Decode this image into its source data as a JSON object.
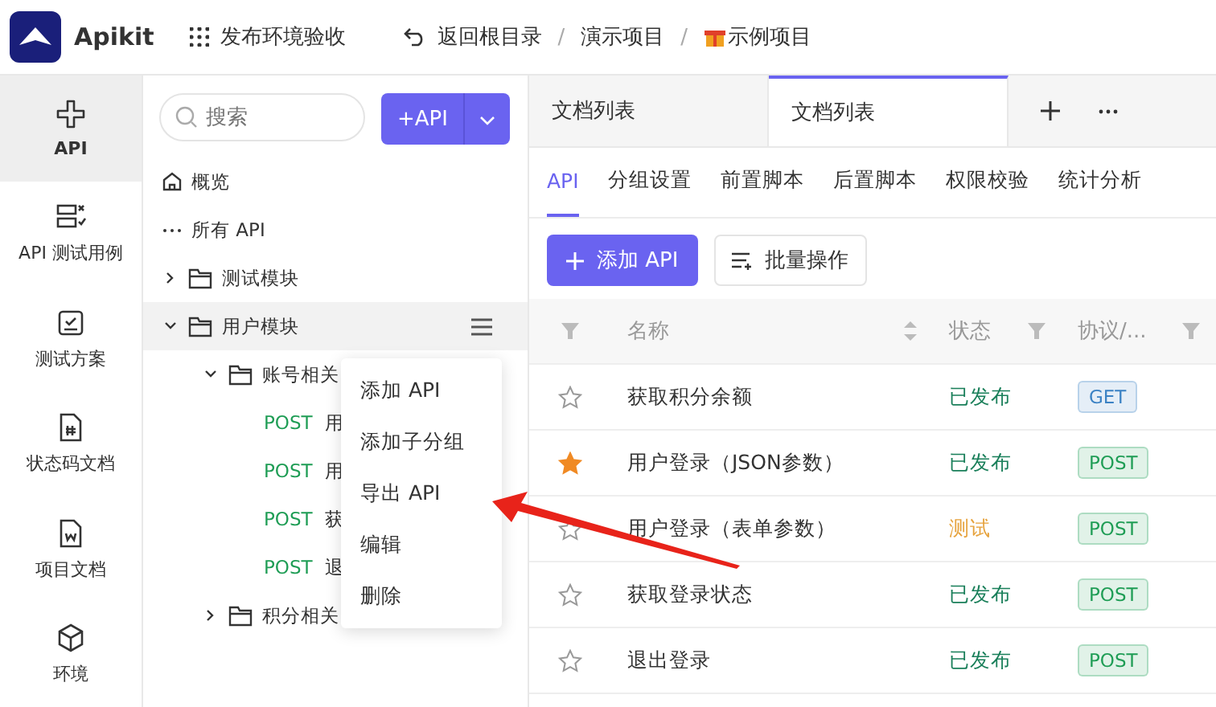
{
  "header": {
    "logo": "Apikit",
    "workspace": "发布环境验收",
    "back": "返回根目录",
    "separator": "/",
    "breadcrumbs": [
      "演示项目",
      "示例项目"
    ]
  },
  "nav": [
    {
      "label": "API",
      "selected": true,
      "kind": "api"
    },
    {
      "label": "API 测试用例",
      "selected": false,
      "kind": "cases"
    },
    {
      "label": "测试方案",
      "selected": false,
      "kind": "plan"
    },
    {
      "label": "状态码文档",
      "selected": false,
      "kind": "code"
    },
    {
      "label": "项目文档",
      "selected": false,
      "kind": "doc"
    },
    {
      "label": "环境",
      "selected": false,
      "kind": "env"
    }
  ],
  "tree": {
    "search": {
      "placeholder": "搜索"
    },
    "add_button": "+API",
    "items": [
      {
        "kind": "overview",
        "label": "概览",
        "selected": false
      },
      {
        "kind": "all",
        "label": "所有 API",
        "selected": false
      },
      {
        "kind": "folder",
        "label": "测试模块",
        "expanded": false,
        "selected": false
      },
      {
        "kind": "folder",
        "label": "用户模块",
        "expanded": true,
        "selected": true,
        "children": [
          {
            "kind": "folder",
            "label": "账号相关",
            "expanded": true,
            "selected": false,
            "children": [
              {
                "kind": "api",
                "method": "POST",
                "label": "用",
                "selected": false
              },
              {
                "kind": "api",
                "method": "POST",
                "label": "用",
                "selected": false
              },
              {
                "kind": "api",
                "method": "POST",
                "label": "获",
                "selected": false
              },
              {
                "kind": "api",
                "method": "POST",
                "label": "退",
                "selected": false
              }
            ]
          },
          {
            "kind": "folder",
            "label": "积分相关",
            "expanded": false,
            "selected": false
          }
        ]
      }
    ]
  },
  "context_menu": [
    "添加 API",
    "添加子分组",
    "导出 API",
    "编辑",
    "删除"
  ],
  "tabs": [
    {
      "label": "文档列表",
      "selected": false
    },
    {
      "label": "文档列表",
      "selected": true
    }
  ],
  "subtabs": [
    {
      "label": "API",
      "selected": true
    },
    {
      "label": "分组设置",
      "selected": false
    },
    {
      "label": "前置脚本",
      "selected": false
    },
    {
      "label": "后置脚本",
      "selected": false
    },
    {
      "label": "权限校验",
      "selected": false
    },
    {
      "label": "统计分析",
      "selected": false
    }
  ],
  "toolbar": {
    "add_button": "添加 API",
    "batch_button": "批量操作"
  },
  "table": {
    "columns": [
      "名称",
      "状态",
      "协议/..."
    ],
    "rows": [
      {
        "starred": false,
        "name": "获取积分余额",
        "status": {
          "text": "已发布",
          "color": "#1a7f5a"
        },
        "method": {
          "text": "GET",
          "color": "#3b82c4"
        }
      },
      {
        "starred": true,
        "name": "用户登录（JSON参数）",
        "status": {
          "text": "已发布",
          "color": "#1a7f5a"
        },
        "method": {
          "text": "POST",
          "color": "#1f9d55"
        }
      },
      {
        "starred": false,
        "name": "用户登录（表单参数）",
        "status": {
          "text": "测试",
          "color": "#e6a23c"
        },
        "method": {
          "text": "POST",
          "color": "#1f9d55"
        }
      },
      {
        "starred": false,
        "name": "获取登录状态",
        "status": {
          "text": "已发布",
          "color": "#1a7f5a"
        },
        "method": {
          "text": "POST",
          "color": "#1f9d55"
        }
      },
      {
        "starred": false,
        "name": "退出登录",
        "status": {
          "text": "已发布",
          "color": "#1a7f5a"
        },
        "method": {
          "text": "POST",
          "color": "#1f9d55"
        }
      }
    ]
  }
}
